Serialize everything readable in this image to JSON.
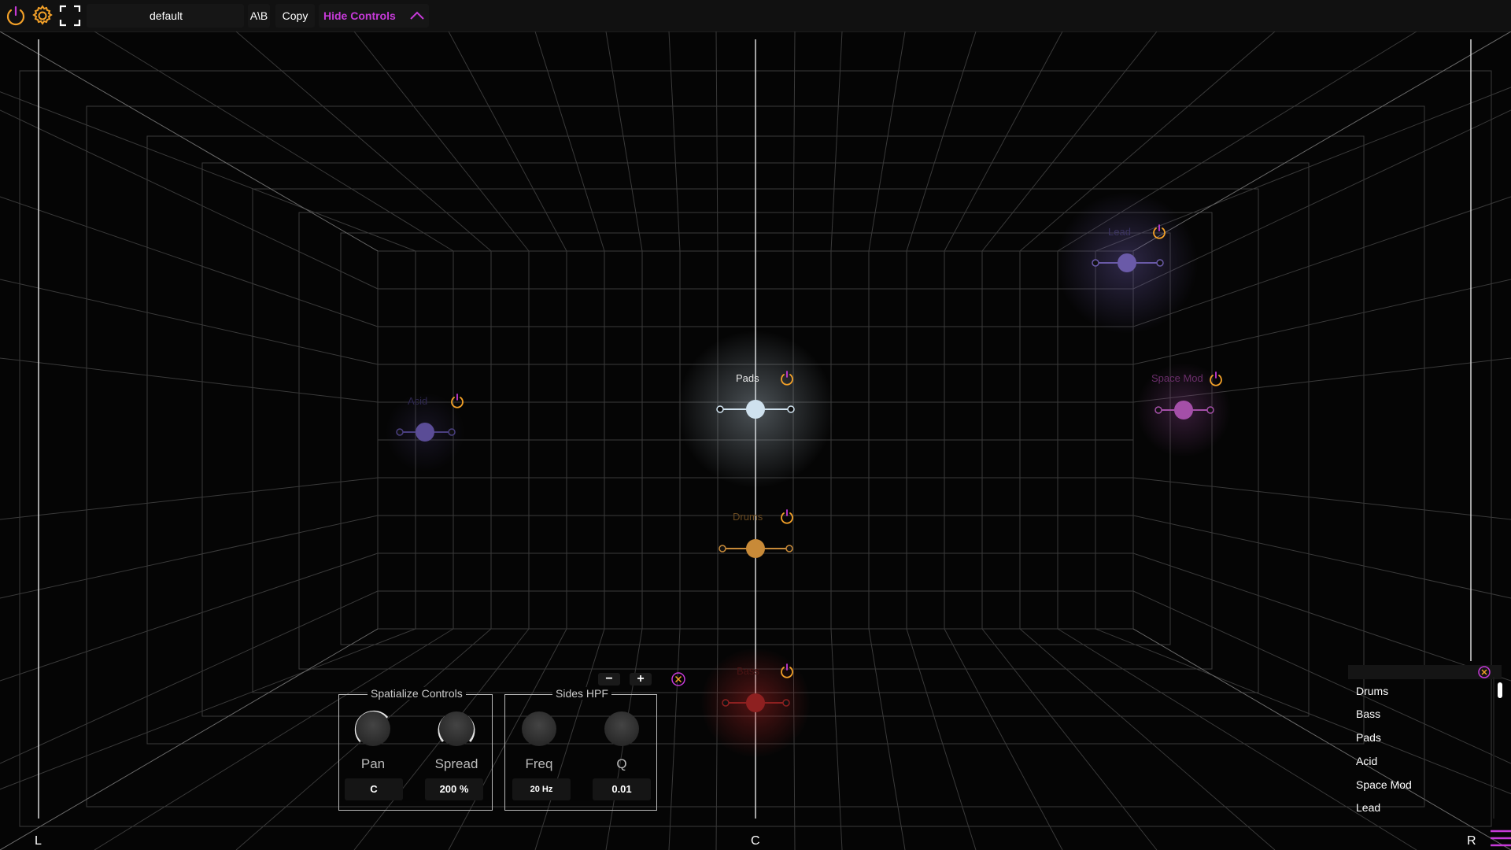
{
  "toolbar": {
    "preset_name": "default",
    "ab_label": "A\\B",
    "copy_label": "Copy",
    "hide_controls_label": "Hide Controls",
    "icons": [
      "power-icon",
      "gear-icon",
      "fullscreen-icon",
      "chevron-up-icon"
    ]
  },
  "colors": {
    "accent_orange": "#f2a028",
    "accent_magenta": "#c63ad8",
    "pads": "#cfe1ee",
    "drums": "#c88a38",
    "bass": "#8e2020",
    "acid": "#5a4c96",
    "space_mod": "#a44fa8",
    "lead": "#6a5aa8"
  },
  "nodes": {
    "pads": "Pads",
    "drums": "Drums",
    "bass": "Bass",
    "acid": "Acid",
    "space_mod": "Space Mod",
    "lead": "Lead"
  },
  "axis": {
    "left": "L",
    "center": "C",
    "right": "R"
  },
  "controls": {
    "spatialize_title": "Spatialize Controls",
    "pan_label": "Pan",
    "pan_value": "C",
    "spread_label": "Spread",
    "spread_value": "200 %",
    "sides_hpf_title": "Sides HPF",
    "freq_label": "Freq",
    "freq_value": "20 Hz",
    "q_label": "Q",
    "q_value": "0.01",
    "minus_label": "−",
    "plus_label": "+"
  },
  "track_list": {
    "items": [
      "Drums",
      "Bass",
      "Pads",
      "Acid",
      "Space Mod",
      "Lead"
    ]
  }
}
